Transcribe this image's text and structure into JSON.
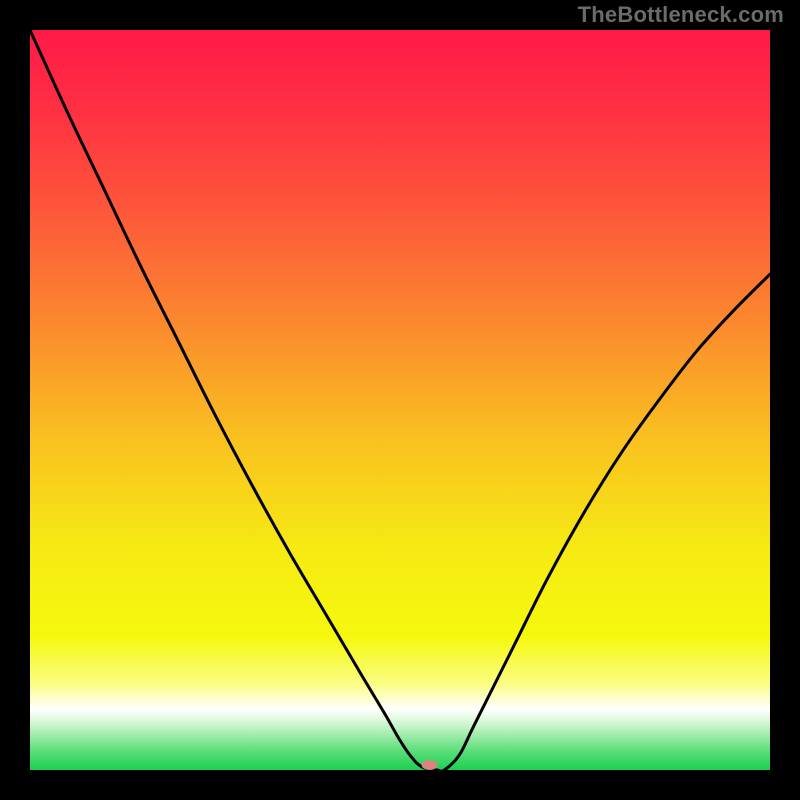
{
  "watermark": {
    "text": "TheBottleneck.com"
  },
  "chart_data": {
    "type": "line",
    "title": "",
    "xlabel": "",
    "ylabel": "",
    "xlim": [
      0,
      100
    ],
    "ylim": [
      0,
      100
    ],
    "grid": false,
    "series": [
      {
        "name": "curve",
        "x": [
          0,
          5,
          10,
          15,
          20,
          25,
          30,
          35,
          40,
          45,
          48,
          50,
          51.5,
          53,
          55,
          56,
          58,
          60,
          65,
          70,
          75,
          80,
          85,
          90,
          95,
          100
        ],
        "values": [
          100,
          89,
          78.5,
          68,
          58,
          48,
          38.5,
          29.5,
          21,
          12.5,
          7.5,
          4,
          1.8,
          0.4,
          0,
          0,
          2,
          6,
          16,
          26,
          35,
          43,
          50,
          56.5,
          62,
          67
        ],
        "color": "#000000"
      }
    ],
    "background_gradient": {
      "stops": [
        {
          "offset": 0.0,
          "color": "#fe1a47"
        },
        {
          "offset": 0.1,
          "color": "#fe2e43"
        },
        {
          "offset": 0.25,
          "color": "#fd593a"
        },
        {
          "offset": 0.4,
          "color": "#fb8a2e"
        },
        {
          "offset": 0.55,
          "color": "#f9c020"
        },
        {
          "offset": 0.7,
          "color": "#f6ea14"
        },
        {
          "offset": 0.82,
          "color": "#f5f90d"
        },
        {
          "offset": 0.885,
          "color": "#fbfd87"
        },
        {
          "offset": 0.905,
          "color": "#fefed1"
        },
        {
          "offset": 0.918,
          "color": "#ffffff"
        },
        {
          "offset": 0.93,
          "color": "#e4fae2"
        },
        {
          "offset": 0.95,
          "color": "#a9eeb0"
        },
        {
          "offset": 0.975,
          "color": "#59dd78"
        },
        {
          "offset": 1.0,
          "color": "#1cd050"
        }
      ]
    },
    "marker": {
      "x": 54,
      "y": 0,
      "rx": 8,
      "ry": 5,
      "color": "#d5877e"
    }
  }
}
